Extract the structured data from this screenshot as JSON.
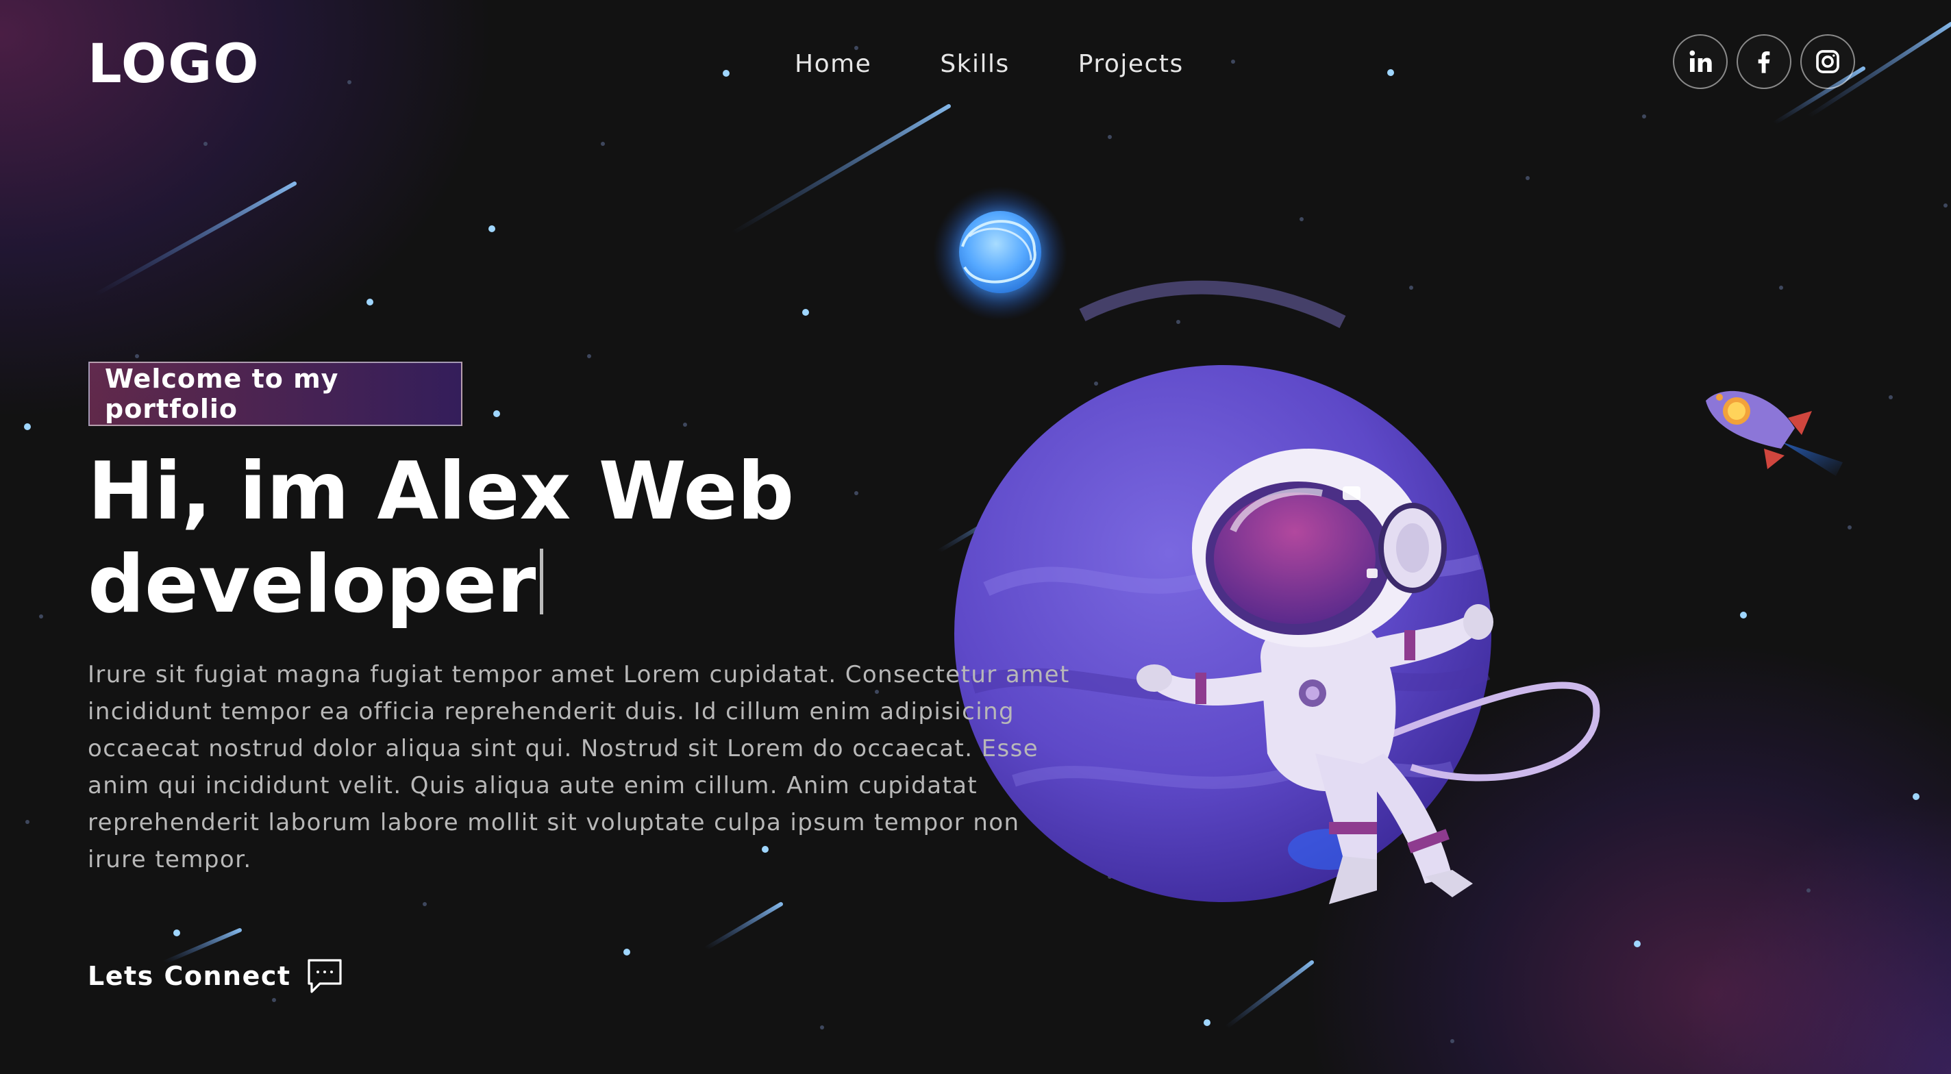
{
  "nav": {
    "logo": "LOGO",
    "links": [
      "Home",
      "Skills",
      "Projects"
    ],
    "social": [
      {
        "name": "linkedin",
        "icon": "linkedin-icon"
      },
      {
        "name": "facebook",
        "icon": "facebook-icon"
      },
      {
        "name": "instagram",
        "icon": "instagram-icon"
      }
    ]
  },
  "hero": {
    "tagline": "Welcome to my portfolio",
    "headline_line1": "Hi, im Alex Web",
    "headline_line2": "developer",
    "description": "Irure sit fugiat magna fugiat tempor amet Lorem cupidatat. Consectetur amet incididunt tempor ea officia reprehenderit duis. Id cillum enim adipisicing occaecat nostrud dolor aliqua sint qui. Nostrud sit Lorem do occaecat. Esse anim qui incididunt velit. Quis aliqua aute enim cillum. Anim cupidatat reprehenderit laborum labore mollit sit voluptate culpa ipsum tempor non irure tempor.",
    "cta_label": "Lets Connect",
    "cta_icon": "chat-bubble-icon"
  },
  "colors": {
    "background": "#121212",
    "accent_purple": "#6a4fd0",
    "accent_magenta": "#9b3a8a",
    "star_blue": "#8fd0ff"
  }
}
